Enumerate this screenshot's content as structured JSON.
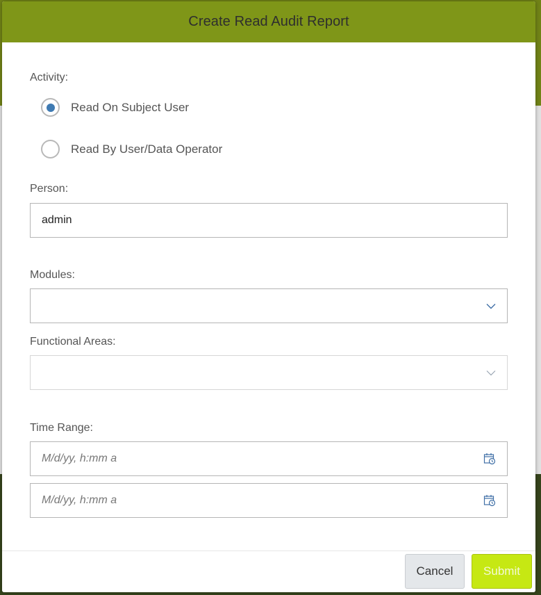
{
  "dialog": {
    "title": "Create Read Audit Report"
  },
  "activity": {
    "label": "Activity:",
    "options": [
      {
        "label": "Read On Subject User",
        "checked": true
      },
      {
        "label": "Read By User/Data Operator",
        "checked": false
      }
    ]
  },
  "person": {
    "label": "Person:",
    "value": "admin"
  },
  "modules": {
    "label": "Modules:",
    "value": ""
  },
  "functional_areas": {
    "label": "Functional Areas:",
    "value": ""
  },
  "time_range": {
    "label": "Time Range:",
    "start_placeholder": "M/d/yy, h:mm a",
    "end_placeholder": "M/d/yy, h:mm a"
  },
  "footer": {
    "cancel_label": "Cancel",
    "submit_label": "Submit"
  },
  "colors": {
    "header": "#7f9618",
    "radio_selected": "#3f7ab2",
    "submit": "#c6e813",
    "icon": "#3f6fa6"
  },
  "icons": {
    "chevron": "chevron-down-icon",
    "calendar": "calendar-clock-icon"
  }
}
